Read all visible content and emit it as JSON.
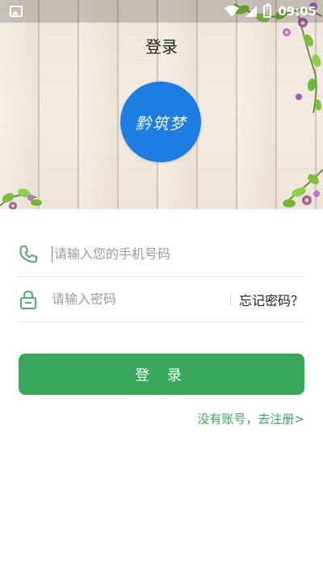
{
  "status_bar": {
    "time": "09:05",
    "icons": [
      "gallery-icon",
      "wifi-icon",
      "signal-icon",
      "battery-charging-icon"
    ]
  },
  "header": {
    "title": "登录",
    "logo_text": "黔筑梦"
  },
  "form": {
    "phone": {
      "placeholder": "请输入您的手机号码",
      "value": "",
      "icon": "phone-icon"
    },
    "password": {
      "placeholder": "请输入密码",
      "value": "",
      "icon": "lock-icon"
    },
    "forgot_label": "忘记密码？"
  },
  "actions": {
    "login_label": "登 录",
    "register_label": "没有账号，去注册>"
  },
  "colors": {
    "accent": "#3aa85b",
    "logo_bg": "#1e7de0",
    "text": "#222222",
    "placeholder": "#9b9b9b"
  }
}
